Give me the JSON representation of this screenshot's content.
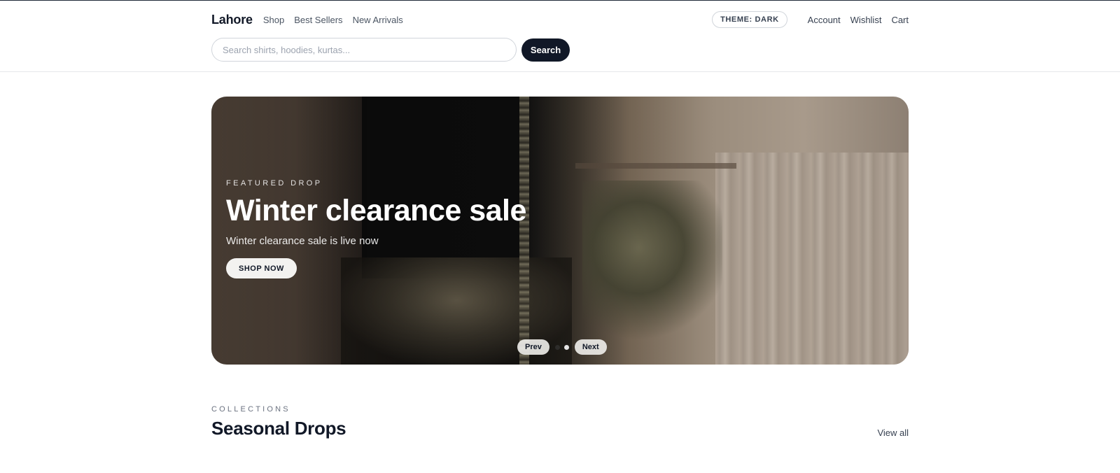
{
  "header": {
    "logo": "Lahore",
    "nav": [
      "Shop",
      "Best Sellers",
      "New Arrivals"
    ],
    "theme_toggle": "THEME: DARK",
    "right_links": [
      "Account",
      "Wishlist",
      "Cart"
    ]
  },
  "search": {
    "placeholder": "Search shirts, hoodies, kurtas...",
    "value": "",
    "button_label": "Search"
  },
  "hero": {
    "eyebrow": "FEATURED DROP",
    "title": "Winter clearance sale",
    "subtitle": "Winter clearance sale is live now",
    "cta": "SHOP NOW",
    "prev_label": "Prev",
    "next_label": "Next",
    "slide_count": 2,
    "active_slide": 2
  },
  "collections": {
    "eyebrow": "COLLECTIONS",
    "title": "Seasonal Drops",
    "view_all": "View all"
  },
  "colors": {
    "primary": "#111827",
    "muted": "#6b7280",
    "border": "#e5e7eb"
  }
}
